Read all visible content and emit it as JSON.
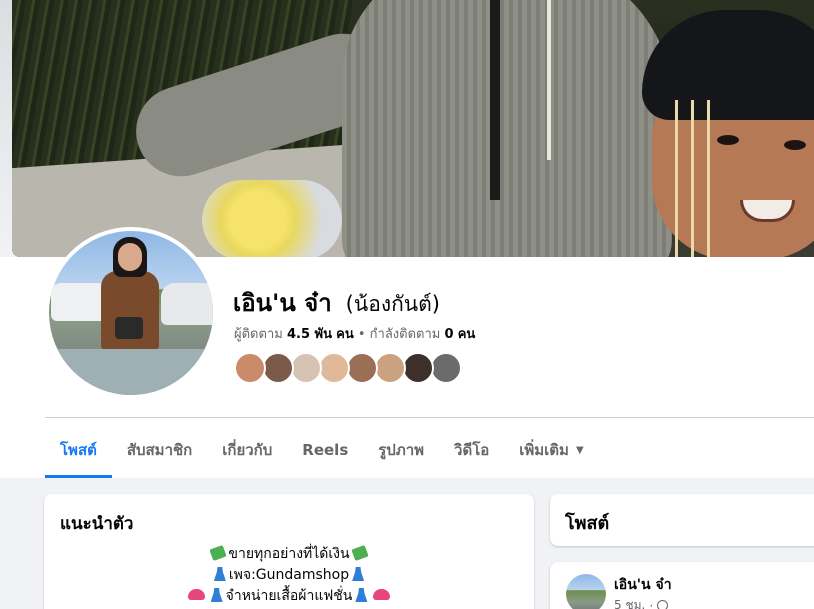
{
  "profile": {
    "name": "เอิน'น จ๋า",
    "alternate_name": "(น้องกันต์)",
    "followers_label": "ผู้ติดตาม",
    "followers_count": "4.5 พัน",
    "followers_unit": "คน",
    "separator": "•",
    "following_label": "กำลังติดตาม",
    "following_count": "0",
    "following_unit": "คน"
  },
  "friend_avatars": [
    "#c98b6a",
    "#7b5a48",
    "#d7c3b2",
    "#e0b89a",
    "#9a6f55",
    "#caa27f",
    "#3d2f2a",
    "#6b6b6b"
  ],
  "tabs": [
    {
      "label": "โพสต์",
      "active": true
    },
    {
      "label": "สับสมาชิก",
      "active": false
    },
    {
      "label": "เกี่ยวกับ",
      "active": false
    },
    {
      "label": "Reels",
      "active": false
    },
    {
      "label": "รูปภาพ",
      "active": false
    },
    {
      "label": "วิดีโอ",
      "active": false
    },
    {
      "label": "เพิ่มเติม",
      "active": false,
      "dropdown": true
    }
  ],
  "intro": {
    "title": "แนะนำตัว",
    "line1": "ขายทุกอย่างที่ได้เงิน",
    "line2": "เพจ:Gundamshop",
    "line3": "จำหน่ายเสื้อผ้าแฟชั่น"
  },
  "posts": {
    "title": "โพสต์",
    "first_post": {
      "author": "เอิน'น จ๋า",
      "time": "5 ชม.",
      "dot": "·"
    }
  }
}
